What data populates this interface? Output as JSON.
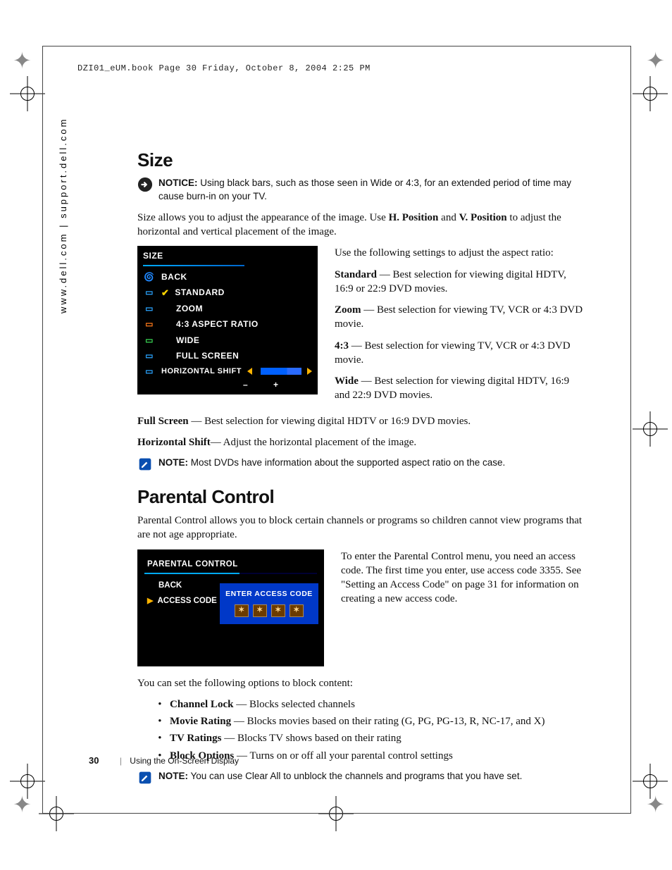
{
  "header": "DZI01_eUM.book  Page 30  Friday, October 8, 2004  2:25 PM",
  "side_url": "www.dell.com | support.dell.com",
  "size": {
    "heading": "Size",
    "notice_label": "NOTICE:",
    "notice": "Using black bars, such as those seen in Wide or 4:3, for an extended period of time may cause burn-in on your TV.",
    "intro_a": "Size allows you to adjust the appearance of the image. Use ",
    "intro_hpos": "H. Position",
    "intro_b": " and ",
    "intro_vpos": "V. Position",
    "intro_c": " to adjust the horizontal and vertical placement of the image.",
    "osd": {
      "title": "SIZE",
      "back": "BACK",
      "standard": "STANDARD",
      "zoom": "ZOOM",
      "ratio43": "4:3 ASPECT RATIO",
      "wide": "WIDE",
      "full": "FULL SCREEN",
      "hshift": "HORIZONTAL SHIFT",
      "minus": "–",
      "plus": "+"
    },
    "right": {
      "lead": "Use the following settings to adjust the aspect ratio:",
      "std_l": "Standard",
      "std_t": " — Best selection for viewing digital HDTV, 16:9 or 22:9 DVD movies.",
      "zoom_l": "Zoom",
      "zoom_t": " — Best selection for viewing TV, VCR or 4:3 DVD movie.",
      "r43_l": "4:3",
      "r43_t": " — Best selection for viewing TV, VCR or 4:3 DVD movie.",
      "wide_l": "Wide",
      "wide_t": " — Best selection for viewing digital HDTV, 16:9 and 22:9 DVD movies."
    },
    "full_l": "Full Screen",
    "full_t": " — Best selection for viewing digital HDTV or 16:9 DVD movies.",
    "hs_l": "Horizontal Shift",
    "hs_t": "— Adjust the horizontal placement of the image.",
    "note_label": "NOTE:",
    "note": "Most DVDs have information about the supported aspect ratio on the case."
  },
  "pc": {
    "heading": "Parental Control",
    "intro": "Parental Control allows you to block certain channels or programs so children cannot view programs that are not age appropriate.",
    "osd": {
      "title": "PARENTAL CONTROL",
      "back": "BACK",
      "access": "ACCESS CODE",
      "enter": "ENTER ACCESS CODE",
      "x": "✶"
    },
    "right": "To enter the Parental Control menu, you need an access code. The first time you enter, use access code 3355. See \"Setting an Access Code\" on page 31 for information on creating a new access code.",
    "after": "You can set the following options to block content:",
    "opts": {
      "cl_l": "Channel Lock",
      "cl_t": " — Blocks selected channels",
      "mr_l": "Movie Rating",
      "mr_t": " — Blocks movies based on their rating (G, PG, PG-13, R, NC-17, and X)",
      "tv_l": "TV Ratings",
      "tv_t": " — Blocks TV shows based on their rating",
      "bo_l": "Block Options",
      "bo_t": " — Turns on or off all your parental control settings"
    },
    "note_label": "NOTE:",
    "note": "You can use Clear All to unblock the channels and programs that you have set."
  },
  "footer": {
    "page": "30",
    "section": "Using the On-Screen Display"
  }
}
